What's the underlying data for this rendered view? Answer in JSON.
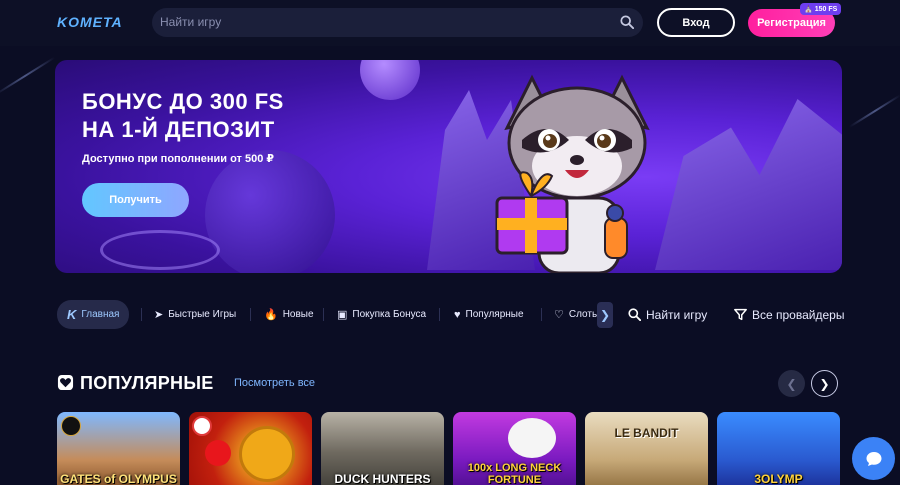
{
  "header": {
    "logo": "KOMETA",
    "search_placeholder": "Найти игру",
    "login_label": "Вход",
    "register_label": "Регистрация",
    "register_badge": "150 FS"
  },
  "banner": {
    "title_line1": "БОНУС ДО 300 FS",
    "title_line2": "НА 1-Й ДЕПОЗИТ",
    "subtitle": "Доступно при пополнении от 500 ₽",
    "button_label": "Получить"
  },
  "nav": {
    "home": "Главная",
    "fast_games": "Быстрые Игры",
    "new": "Новые",
    "buy_bonus": "Покупка Бонуса",
    "popular": "Популярные",
    "slots": "Слоты",
    "find_game": "Найти игру",
    "all_providers": "Все провайдеры"
  },
  "section": {
    "title": "ПОПУЛЯРНЫЕ",
    "see_all": "Посмотреть все"
  },
  "games": [
    {
      "title": "GATES of OLYMPUS"
    },
    {
      "title": ""
    },
    {
      "title": "DUCK HUNTERS"
    },
    {
      "title": "100x LONG NECK FORTUNE"
    },
    {
      "title": "LE BANDIT"
    },
    {
      "title": "3OLYMP"
    }
  ],
  "colors": {
    "background": "#0b0d24",
    "accent_pink": "#ff1f9e",
    "accent_blue": "#62c7ff",
    "banner_purple": "#5a22d6"
  }
}
